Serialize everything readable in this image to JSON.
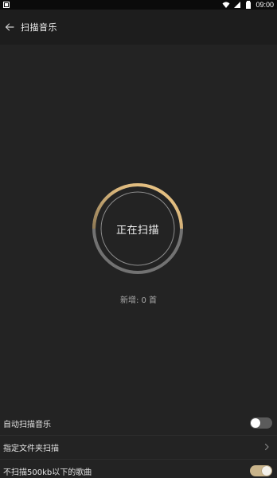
{
  "status_bar": {
    "time": "09:00",
    "icons": [
      "app-notification-icon",
      "wifi-icon",
      "signal-icon",
      "battery-icon"
    ]
  },
  "header": {
    "title": "扫描音乐",
    "back_icon": "arrow-left-icon"
  },
  "scan": {
    "status_label": "正在扫描",
    "new_count": "新增: 0 首",
    "progress_fraction": 0.5
  },
  "settings": {
    "rows": [
      {
        "label": "自动扫描音乐",
        "control": "toggle",
        "enabled": false
      },
      {
        "label": "指定文件夹扫描",
        "control": "chevron"
      },
      {
        "label": "不扫描500kb以下的歌曲",
        "control": "toggle",
        "enabled": true
      }
    ]
  },
  "colors": {
    "background": "#232323",
    "header_background": "#1d1d1d",
    "accent_gold": "#e9c27e",
    "ring_track": "#6e6e6e",
    "toggle_on": "#c9b48b",
    "toggle_off": "#5b5b5b"
  }
}
